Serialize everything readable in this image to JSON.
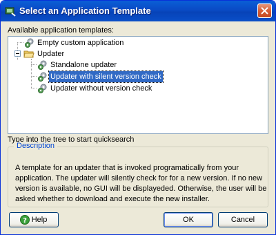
{
  "window": {
    "title": "Select an Application Template"
  },
  "icons": {
    "title": "app-launcher-icon",
    "close": "close-icon",
    "node": "gears-icon",
    "folder": "folder-icon",
    "help": "question-icon"
  },
  "tree": {
    "label": "Available application templates:",
    "items": [
      {
        "label": "Empty custom application",
        "icon": "gears-icon",
        "selected": false
      },
      {
        "label": "Updater",
        "icon": "folder-icon",
        "expanded": true
      },
      {
        "label": "Standalone updater",
        "icon": "gears-icon",
        "selected": false
      },
      {
        "label": "Updater with silent version check",
        "icon": "gears-icon",
        "selected": true
      },
      {
        "label": "Updater without version check",
        "icon": "gears-icon",
        "selected": false
      }
    ]
  },
  "quicksearch_hint": "Type into the tree to start quicksearch",
  "description": {
    "legend": "Description",
    "lines": [
      "A template for an updater that is invoked programatically from  your",
      "application. The updater will silently check for for a new version. If no new",
      "version is available, no GUI will be displayeded. Otherwise, the user will be",
      "asked whether to download and execute the new installer."
    ]
  },
  "buttons": {
    "help": "Help",
    "ok": "OK",
    "cancel": "Cancel"
  },
  "colors": {
    "title_bar": "#0a4ac5",
    "dialog_bg": "#ece9d8",
    "selection": "#316ac5",
    "legend_text": "#0046d5",
    "close_button": "#d75d35"
  }
}
